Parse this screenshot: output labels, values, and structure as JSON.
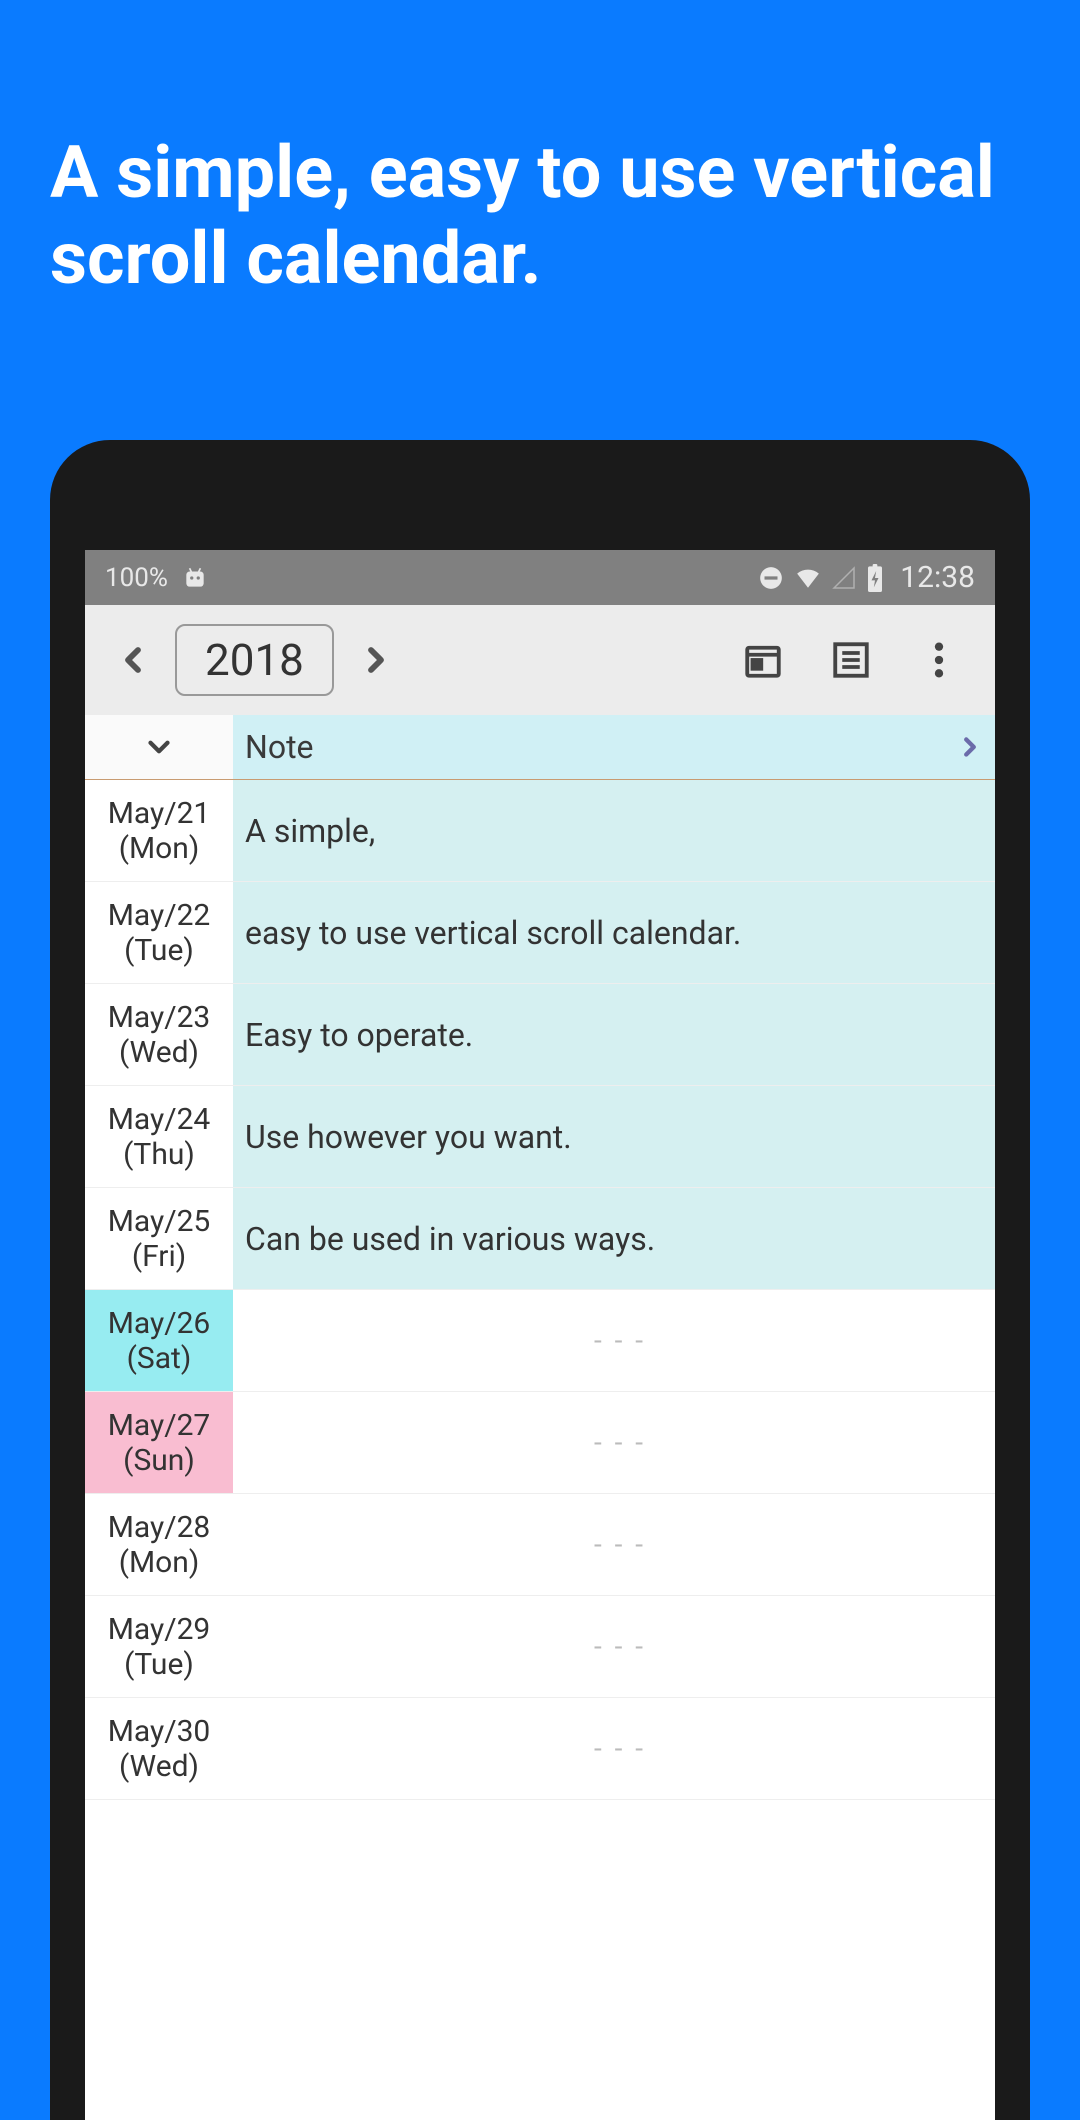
{
  "headline": "A simple, easy to use vertical scroll calendar.",
  "statusbar": {
    "battery_percent": "100%",
    "time": "12:38"
  },
  "toolbar": {
    "year": "2018"
  },
  "note_header": {
    "label": "Note"
  },
  "rows": [
    {
      "date": "May/21",
      "day": "(Mon)",
      "note": "A simple,",
      "kind": "weekday"
    },
    {
      "date": "May/22",
      "day": "(Tue)",
      "note": "easy to use vertical scroll calendar.",
      "kind": "weekday"
    },
    {
      "date": "May/23",
      "day": "(Wed)",
      "note": "Easy to operate.",
      "kind": "weekday"
    },
    {
      "date": "May/24",
      "day": "(Thu)",
      "note": "Use however you want.",
      "kind": "weekday"
    },
    {
      "date": "May/25",
      "day": "(Fri)",
      "note": "Can be used in various ways.",
      "kind": "weekday"
    },
    {
      "date": "May/26",
      "day": "(Sat)",
      "note": "- - -",
      "kind": "sat",
      "empty": true
    },
    {
      "date": "May/27",
      "day": "(Sun)",
      "note": "- - -",
      "kind": "sun",
      "empty": true
    },
    {
      "date": "May/28",
      "day": "(Mon)",
      "note": "- - -",
      "kind": "weekday",
      "empty": true
    },
    {
      "date": "May/29",
      "day": "(Tue)",
      "note": "- - -",
      "kind": "weekday",
      "empty": true
    },
    {
      "date": "May/30",
      "day": "(Wed)",
      "note": "- - -",
      "kind": "weekday",
      "empty": true
    }
  ]
}
